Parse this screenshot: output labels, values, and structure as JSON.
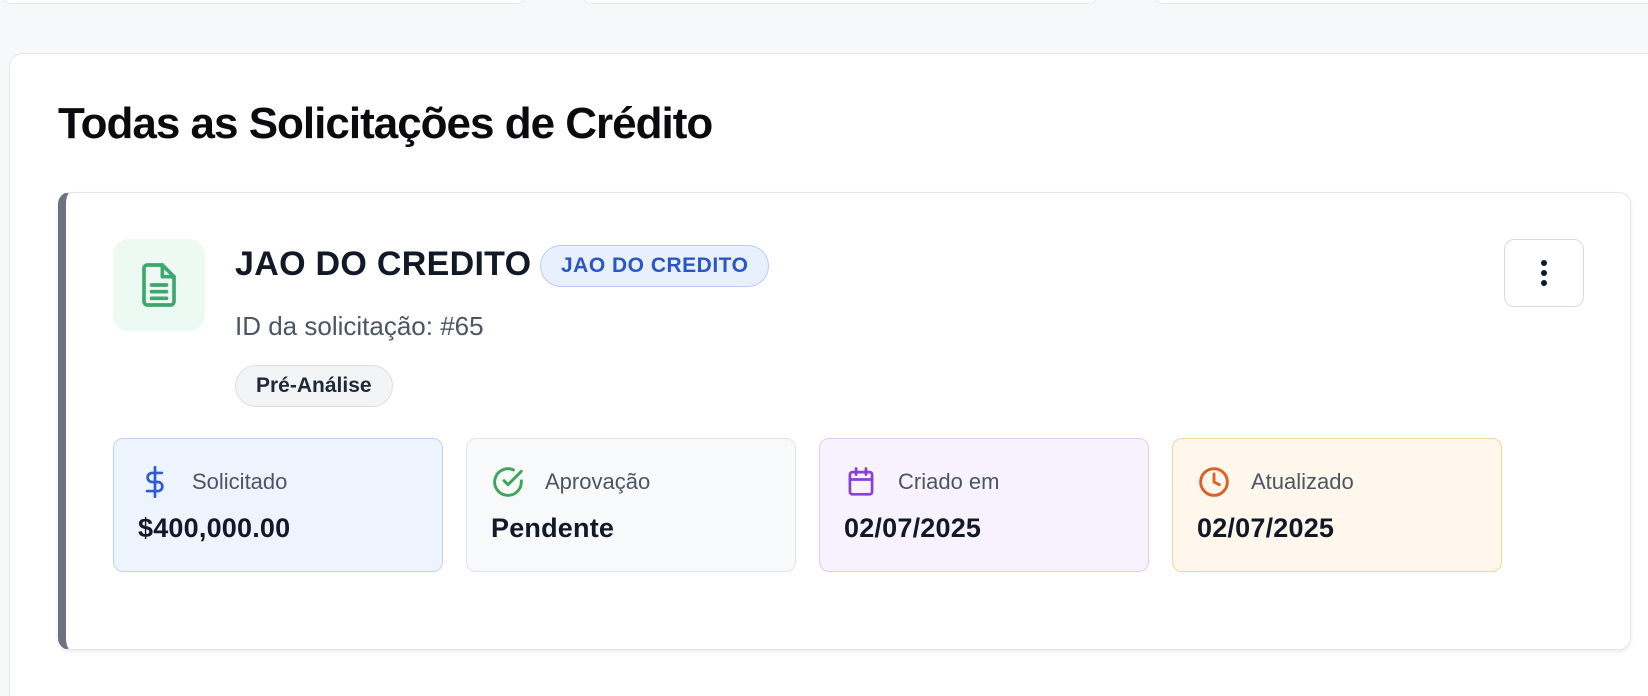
{
  "panel": {
    "title": "Todas as Solicitações de Crédito"
  },
  "request": {
    "name": "JAO DO CREDITO",
    "type_badge": "JAO DO CREDITO",
    "id_text": "ID da solicitação: #65",
    "status": "Pré-Análise",
    "icon": "document-icon",
    "menu_icon": "more-vertical-icon"
  },
  "info": [
    {
      "icon": "dollar-icon",
      "label": "Solicitado",
      "value": "$400,000.00",
      "color": "#2f5bd3"
    },
    {
      "icon": "check-circle-icon",
      "label": "Aprovação",
      "value": "Pendente",
      "color": "#3ea65a"
    },
    {
      "icon": "calendar-icon",
      "label": "Criado em",
      "value": "02/07/2025",
      "color": "#8a3fd6"
    },
    {
      "icon": "clock-icon",
      "label": "Atualizado",
      "value": "02/07/2025",
      "color": "#d9622b"
    }
  ],
  "colors": {
    "accent_blue": "#2a56c8",
    "card_border_left": "#6b7280",
    "doc_icon": "#3ea66f"
  }
}
